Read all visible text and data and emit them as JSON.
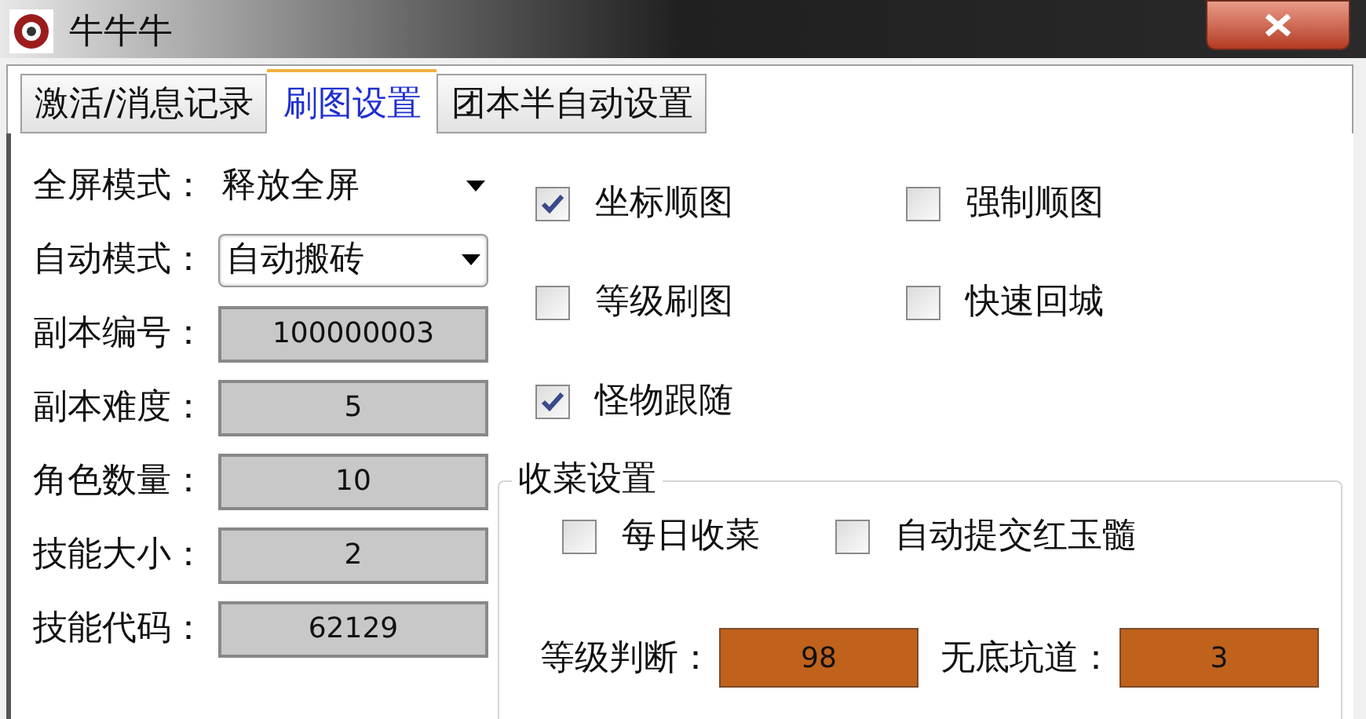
{
  "window": {
    "title": "牛牛牛"
  },
  "tabs": [
    {
      "label": "激活/消息记录",
      "selected": false
    },
    {
      "label": "刷图设置",
      "selected": true
    },
    {
      "label": "团本半自动设置",
      "selected": false
    }
  ],
  "settings": [
    {
      "kind": "flat",
      "label": "全屏模式：",
      "value": "释放全屏"
    },
    {
      "kind": "dropdown",
      "label": "自动模式：",
      "value": "自动搬砖"
    },
    {
      "kind": "field",
      "label": "副本编号：",
      "value": "100000003"
    },
    {
      "kind": "field",
      "label": "副本难度：",
      "value": "5"
    },
    {
      "kind": "field",
      "label": "角色数量：",
      "value": "10"
    },
    {
      "kind": "field",
      "label": "技能大小：",
      "value": "2"
    },
    {
      "kind": "field",
      "label": "技能代码：",
      "value": "62129"
    }
  ],
  "options": [
    {
      "label": "坐标顺图",
      "checked": true
    },
    {
      "label": "强制顺图",
      "checked": false
    },
    {
      "label": "等级刷图",
      "checked": false
    },
    {
      "label": "快速回城",
      "checked": false
    },
    {
      "label": "怪物跟随",
      "checked": true
    }
  ],
  "harvest": {
    "title": "收菜设置",
    "checkboxes": [
      {
        "label": "每日收菜",
        "checked": false
      },
      {
        "label": "自动提交红玉髓",
        "checked": false
      }
    ],
    "fields": [
      {
        "label": "等级判断：",
        "value": "98"
      },
      {
        "label": "无底坑道：",
        "value": "3"
      }
    ]
  }
}
